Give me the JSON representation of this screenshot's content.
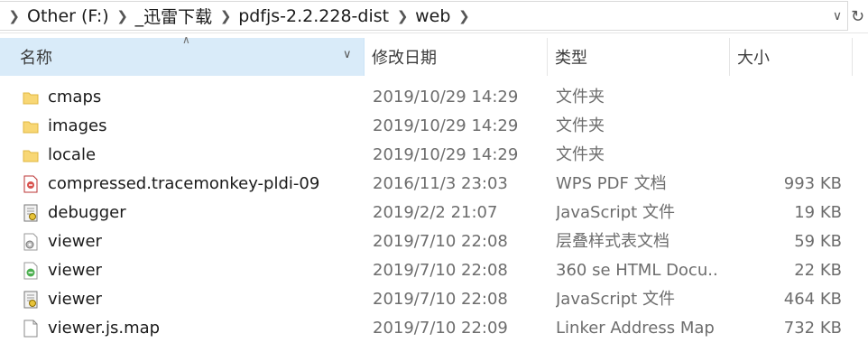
{
  "address": {
    "crumbs": [
      "Other (F:)",
      "_迅雷下载",
      "pdfjs-2.2.228-dist",
      "web"
    ]
  },
  "columns": {
    "name": "名称",
    "date": "修改日期",
    "type": "类型",
    "size": "大小"
  },
  "files": [
    {
      "name": "cmaps",
      "date": "2019/10/29 14:29",
      "type": "文件夹",
      "size": "",
      "icon": "folder-icon"
    },
    {
      "name": "images",
      "date": "2019/10/29 14:29",
      "type": "文件夹",
      "size": "",
      "icon": "folder-icon"
    },
    {
      "name": "locale",
      "date": "2019/10/29 14:29",
      "type": "文件夹",
      "size": "",
      "icon": "folder-icon"
    },
    {
      "name": "compressed.tracemonkey-pldi-09",
      "date": "2016/11/3 23:03",
      "type": "WPS PDF 文档",
      "size": "993 KB",
      "icon": "pdf-file-icon"
    },
    {
      "name": "debugger",
      "date": "2019/2/2 21:07",
      "type": "JavaScript 文件",
      "size": "19 KB",
      "icon": "script-file-icon"
    },
    {
      "name": "viewer",
      "date": "2019/7/10 22:08",
      "type": "层叠样式表文档",
      "size": "59 KB",
      "icon": "css-file-icon"
    },
    {
      "name": "viewer",
      "date": "2019/7/10 22:08",
      "type": "360 se HTML Docu...",
      "size": "22 KB",
      "icon": "html-file-icon"
    },
    {
      "name": "viewer",
      "date": "2019/7/10 22:08",
      "type": "JavaScript 文件",
      "size": "464 KB",
      "icon": "script-file-icon"
    },
    {
      "name": "viewer.js.map",
      "date": "2019/7/10 22:09",
      "type": "Linker Address Map",
      "size": "732 KB",
      "icon": "blank-file-icon"
    }
  ]
}
